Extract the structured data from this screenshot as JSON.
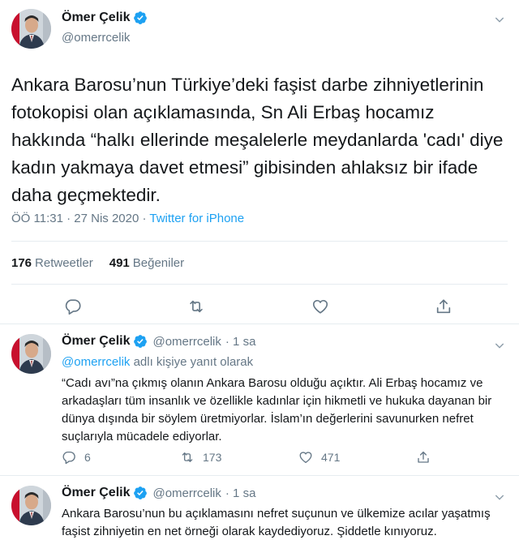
{
  "main_tweet": {
    "author": {
      "name": "Ömer Çelik",
      "handle": "@omerrcelik"
    },
    "text": "Ankara Barosu’nun Türkiye’deki faşist darbe zihniyetlerinin fotokopisi olan açıklamasında, Sn Ali Erbaş hocamız hakkında “halkı ellerinde meşalelerle meydanlarda 'cadı' diye kadın yakmaya davet etmesi” gibisinden ahlaksız bir ifade daha geçmektedir.",
    "timestamp": "ÖÖ 11:31 · 27 Nis 2020",
    "separator": " · ",
    "source": "Twitter for iPhone",
    "retweets_count": "176",
    "retweets_label": "Retweetler",
    "likes_count": "491",
    "likes_label": "Beğeniler",
    "icons": [
      "reply-icon",
      "retweet-icon",
      "like-icon",
      "share-icon"
    ]
  },
  "replies": [
    {
      "author": {
        "name": "Ömer Çelik",
        "handle": "@omerrcelik",
        "time": "· 1 sa"
      },
      "replying_mention": "@omerrcelik",
      "replying_suffix": " adlı kişiye yanıt olarak",
      "text": "“Cadı avı”na çıkmış olanın Ankara Barosu olduğu açıktır. Ali Erbaş hocamız ve arkadaşları tüm insanlık ve özellikle kadınlar için hikmetli ve hukuka dayanan bir dünya dışında bir söylem üretmiyorlar. İslam’ın değerlerini savunurken nefret suçlarıyla mücadele ediyorlar.",
      "reply_count": "6",
      "retweet_count": "173",
      "like_count": "471"
    },
    {
      "author": {
        "name": "Ömer Çelik",
        "handle": "@omerrcelik",
        "time": "· 1 sa"
      },
      "text": "Ankara Barosu’nun bu açıklamasını nefret suçunun ve ülkemize acılar yaşatmış faşist zihniyetin en net örneği olarak kaydediyoruz. Şiddetle kınıyoruz."
    }
  ],
  "colors": {
    "link": "#1da1f2",
    "secondary_text": "#657786",
    "primary_text": "#14171a",
    "border": "#e6ecf0",
    "verified": "#1da1f2"
  }
}
